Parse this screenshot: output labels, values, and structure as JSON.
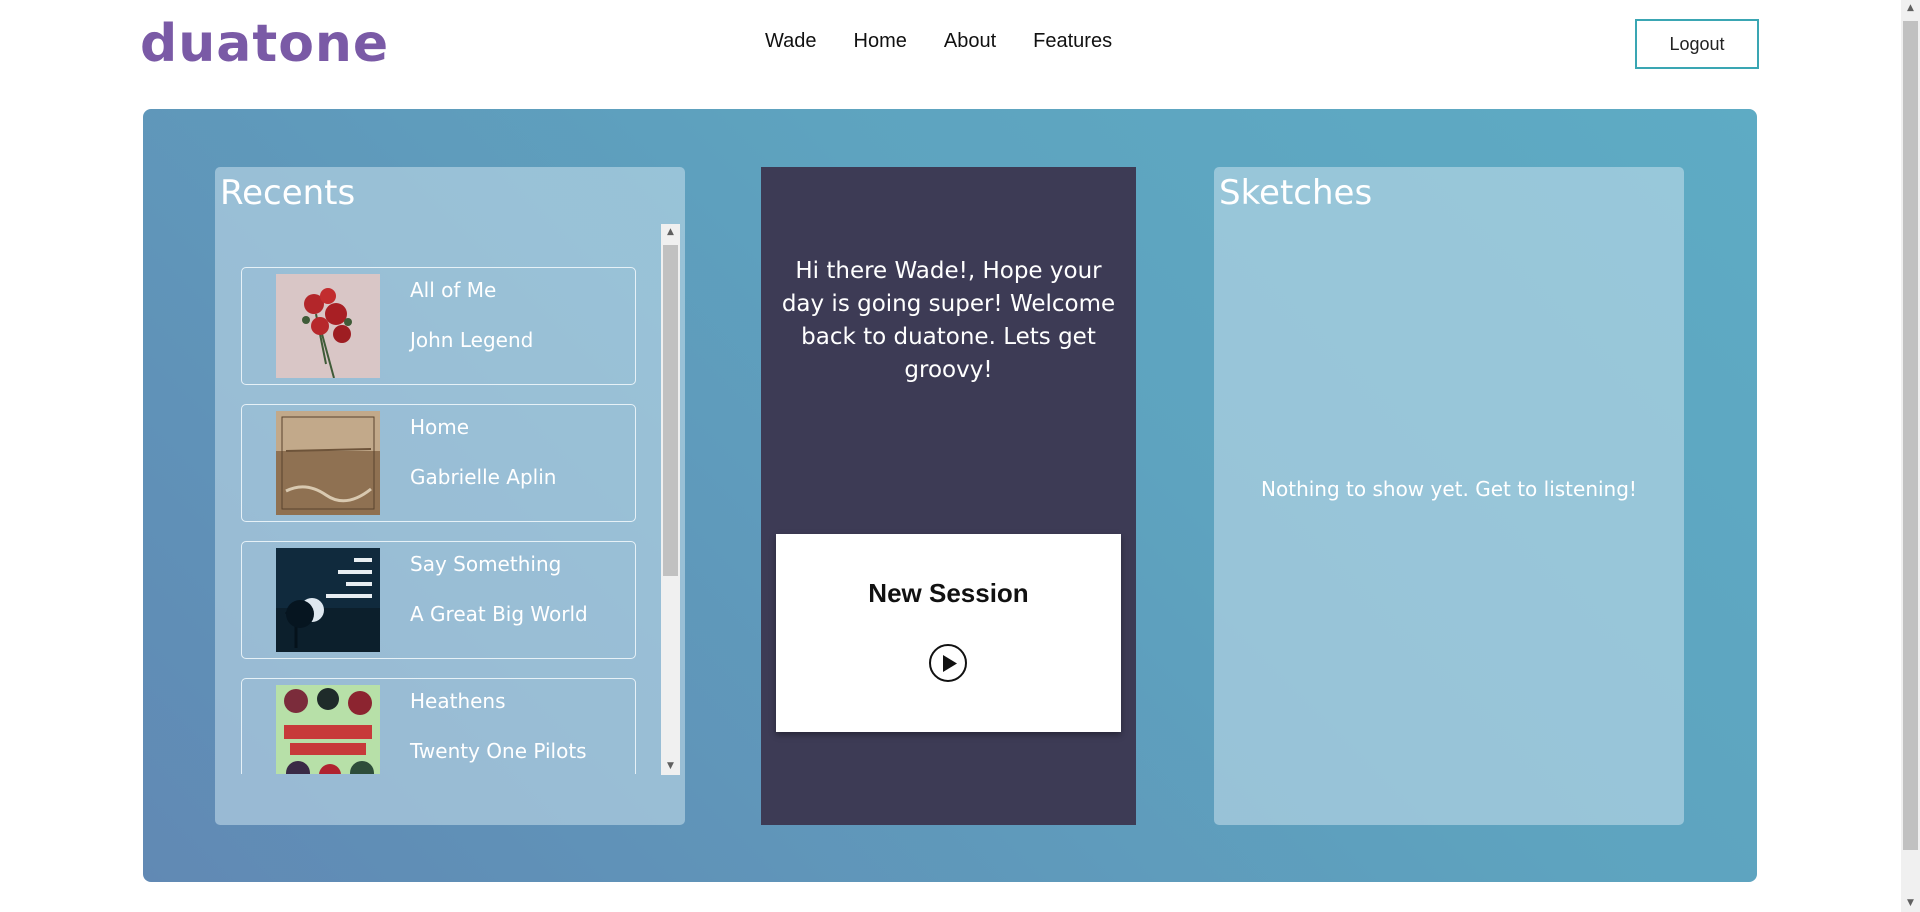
{
  "header": {
    "logo": "duatone",
    "nav": [
      "Wade",
      "Home",
      "About",
      "Features"
    ],
    "logout_label": "Logout"
  },
  "recents": {
    "title": "Recents",
    "songs": [
      {
        "title": "All of Me",
        "artist": "John Legend",
        "art_icon": "roses-cover"
      },
      {
        "title": "Home",
        "artist": "Gabrielle Aplin",
        "art_icon": "sepia-photo-cover"
      },
      {
        "title": "Say Something",
        "artist": "A Great Big World",
        "art_icon": "night-tree-cover"
      },
      {
        "title": "Heathens",
        "artist": "Twenty One Pilots",
        "art_icon": "suicide-squad-cover"
      }
    ]
  },
  "center": {
    "welcome": "Hi there Wade!, Hope your day is going super! Welcome back to duatone. Lets get groovy!",
    "session_title": "New Session",
    "play_icon": "play-icon"
  },
  "sketches": {
    "title": "Sketches",
    "empty_message": "Nothing to show yet. Get to listening!"
  },
  "colors": {
    "brand": "#7a5aa6",
    "accent_border": "#3aa6b3",
    "center_panel": "#3d3b55"
  }
}
